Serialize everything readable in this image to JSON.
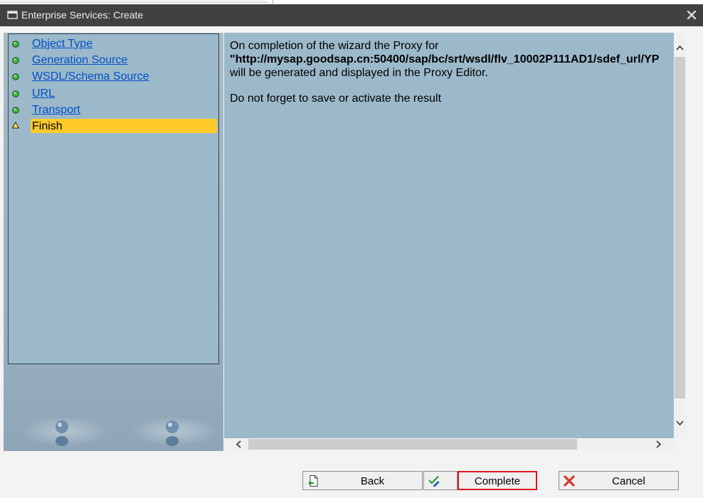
{
  "window": {
    "title": "Enterprise Services: Create"
  },
  "nav": {
    "items": [
      {
        "label": "Object Type",
        "status": "done"
      },
      {
        "label": "Generation Source",
        "status": "done"
      },
      {
        "label": "WSDL/Schema Source",
        "status": "done"
      },
      {
        "label": "URL",
        "status": "done"
      },
      {
        "label": "Transport",
        "status": "done"
      },
      {
        "label": "Finish",
        "status": "current"
      }
    ]
  },
  "content": {
    "line1": "On completion of the wizard the Proxy for",
    "url_line": "\"http://mysap.goodsap.cn:50400/sap/bc/srt/wsdl/flv_10002P111AD1/sdef_url/YP",
    "line3": "will be generated and displayed in the Proxy Editor.",
    "note": "Do not forget to save or activate the result"
  },
  "buttons": {
    "back": "Back",
    "complete": "Complete",
    "cancel": "Cancel"
  },
  "colors": {
    "titlebar": "#414141",
    "panel": "#9cb9ca",
    "highlight": "#ffcb2b",
    "link": "#0050c8",
    "done_dot": "#3fbf3f",
    "focus_border": "#e0141e"
  }
}
